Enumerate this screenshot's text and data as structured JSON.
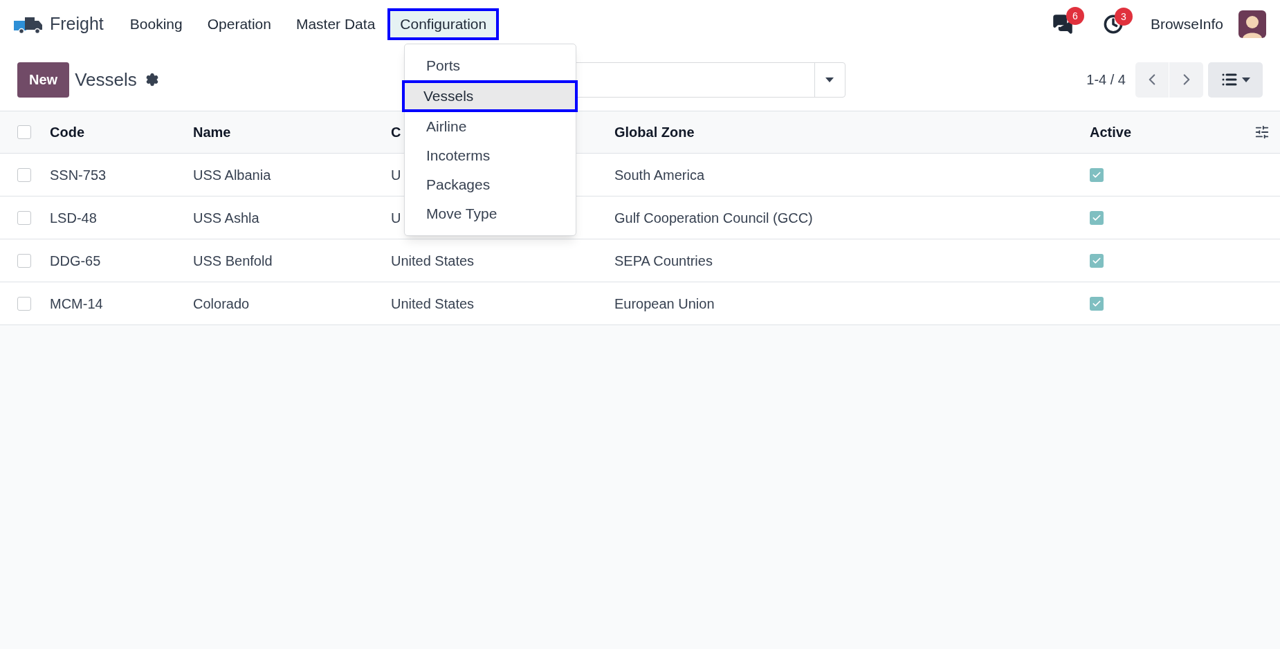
{
  "app": {
    "name": "Freight"
  },
  "menu": [
    {
      "label": "Booking",
      "selected": false
    },
    {
      "label": "Operation",
      "selected": false
    },
    {
      "label": "Master Data",
      "selected": false
    },
    {
      "label": "Configuration",
      "selected": true
    }
  ],
  "dropdown": [
    {
      "label": "Ports",
      "selected": false
    },
    {
      "label": "Vessels",
      "selected": true
    },
    {
      "label": "Airline",
      "selected": false
    },
    {
      "label": "Incoterms",
      "selected": false
    },
    {
      "label": "Packages",
      "selected": false
    },
    {
      "label": "Move Type",
      "selected": false
    }
  ],
  "systray": {
    "messages_count": "6",
    "activities_count": "3",
    "company": "BrowseInfo"
  },
  "control_panel": {
    "new_button": "New",
    "title": "Vessels",
    "pager": "1-4 / 4"
  },
  "table": {
    "columns": [
      "Code",
      "Name",
      "C",
      "Global Zone",
      "Active"
    ],
    "all_checked": false,
    "rows": [
      {
        "checked": false,
        "cells": [
          "SSN-753",
          "USS Albania",
          "U",
          "South America"
        ],
        "active": true
      },
      {
        "checked": false,
        "cells": [
          "LSD-48",
          "USS Ashla",
          "U",
          "Gulf Cooperation Council (GCC)"
        ],
        "active": true
      },
      {
        "checked": false,
        "cells": [
          "DDG-65",
          "USS Benfold",
          "United States",
          "SEPA Countries"
        ],
        "active": true
      },
      {
        "checked": false,
        "cells": [
          "MCM-14",
          "Colorado",
          "United States",
          "European Union"
        ],
        "active": true
      }
    ]
  }
}
